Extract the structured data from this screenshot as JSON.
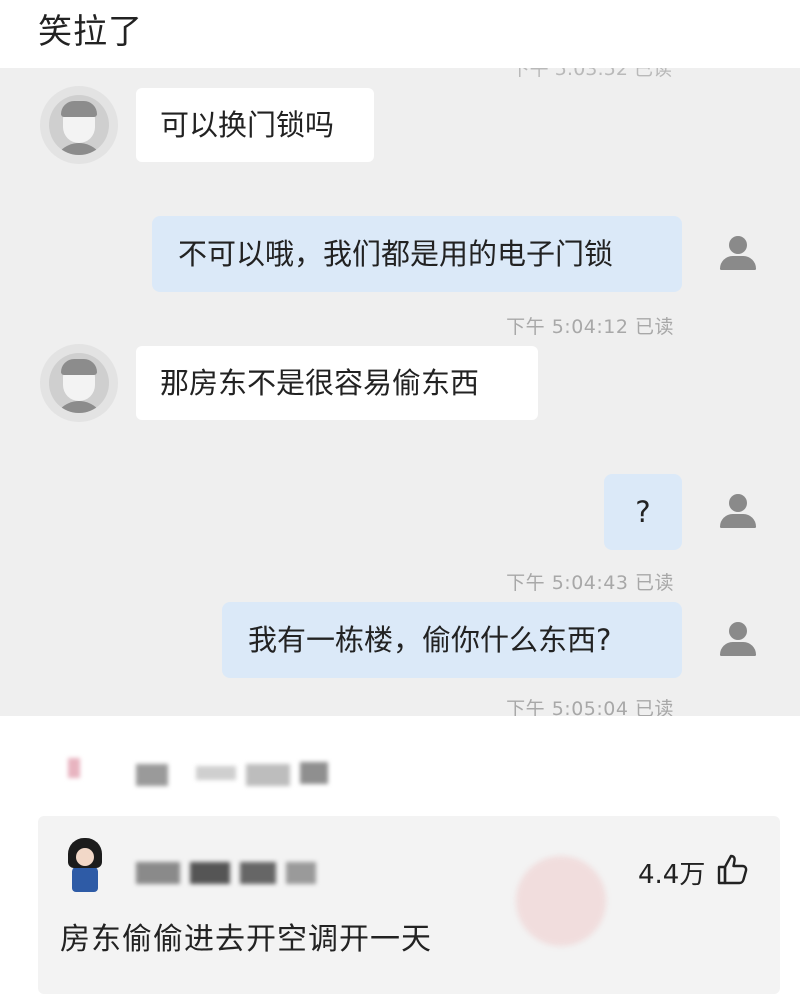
{
  "post": {
    "title": "笑拉了"
  },
  "chat": {
    "messages": [
      {
        "side": "left",
        "text": "可以换门锁吗"
      },
      {
        "side": "right",
        "text": "不可以哦，我们都是用的电子门锁",
        "time": "下午 5:04:12 已读"
      },
      {
        "side": "left",
        "text": "那房东不是很容易偷东西"
      },
      {
        "side": "right",
        "text": "?",
        "time": "下午 5:04:43 已读"
      },
      {
        "side": "right",
        "text": "我有一栋楼，偷你什么东西?",
        "time": "下午 5:05:04 已读"
      }
    ]
  },
  "comment": {
    "likes": "4.4万",
    "text": "房东偷偷进去开空调开一天"
  },
  "colors": {
    "chat_bg": "#efefef",
    "outgoing_bubble": "#dbe9f8",
    "incoming_bubble": "#ffffff",
    "comment_bg": "#f3f3f3"
  },
  "icons": [
    "default-avatar-icon",
    "person-icon",
    "thumbs-up-icon"
  ]
}
